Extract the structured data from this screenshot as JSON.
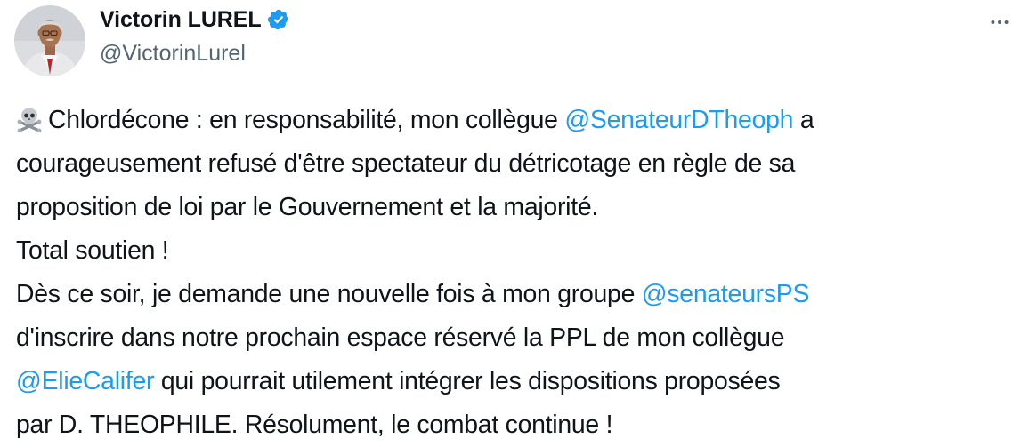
{
  "author": {
    "display_name": "Victorin LUREL",
    "handle": "@VictorinLurel",
    "avatar_icon": "profile-photo",
    "verified_icon": "verified-badge-icon",
    "verified_color": "#1d9bf0"
  },
  "menu": {
    "more_icon": "more-options-icon"
  },
  "tweet": {
    "emoji": "skull-and-crossbones-icon",
    "line1_pre": "Chlordécone : en responsabilité, mon collègue ",
    "mention1": "@SenateurDTheoph",
    "line1_post": " a",
    "line2": "courageusement refusé d'être spectateur du détricotage en règle de sa",
    "line3": "proposition de loi par le Gouvernement et la majorité.",
    "line4": "Total soutien !",
    "line5_pre": "Dès ce soir, je demande une nouvelle fois à mon groupe ",
    "mention2": "@senateursPS",
    "line6": "d'inscrire dans notre prochain espace réservé la PPL de mon collègue",
    "mention3": "@ElieCalifer",
    "line7_post": " qui pourrait utilement intégrer les dispositions proposées",
    "line8": "par D. THEOPHILE. Résolument, le combat continue !"
  },
  "colors": {
    "text": "#0f1419",
    "secondary": "#536471",
    "link": "#1d9bf0"
  }
}
